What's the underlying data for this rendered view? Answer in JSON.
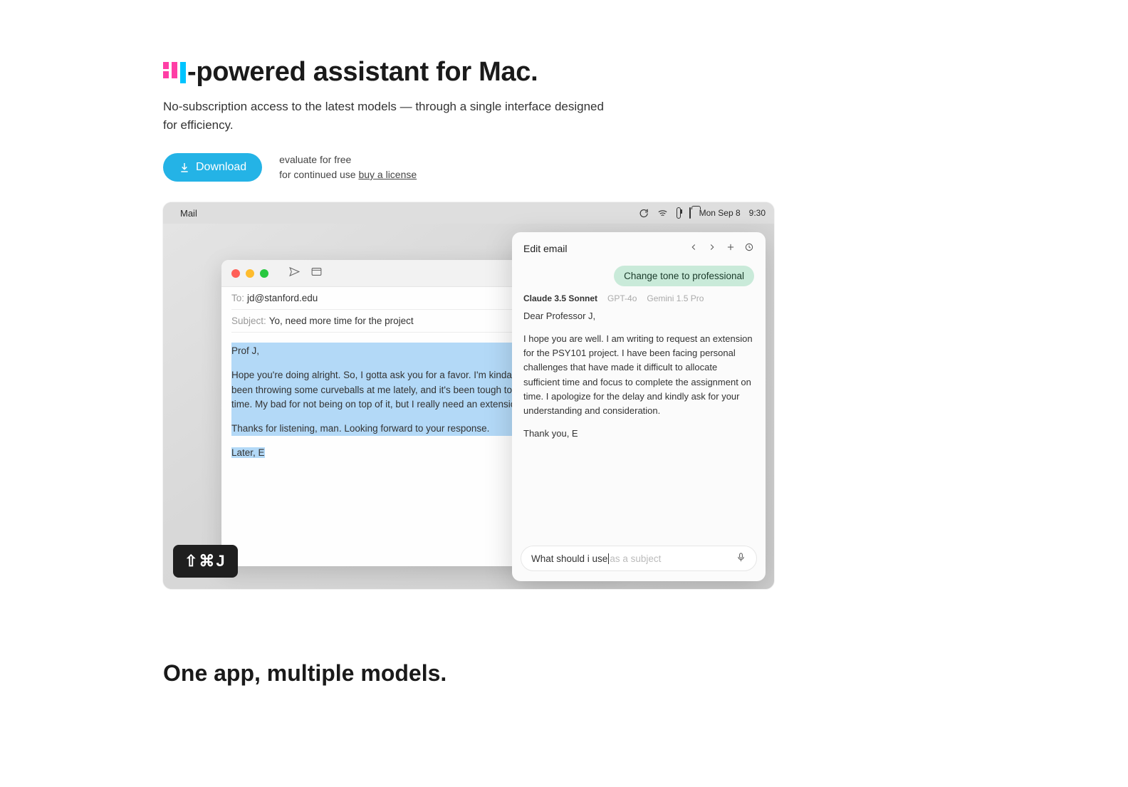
{
  "hero": {
    "title_rest": "-powered assistant for Mac.",
    "sub": "No-subscription access to the latest models — through a single interface designed for efficiency.",
    "download_label": "Download",
    "eval_line1": "evaluate for free",
    "eval_line2_prefix": "for continued use ",
    "eval_link": "buy a license"
  },
  "menubar": {
    "app": "Mail",
    "date": "Mon Sep 8",
    "time": "9:30"
  },
  "mail": {
    "to_label": "To:",
    "to_value": "jd@stanford.edu",
    "subject_label": "Subject:",
    "subject_value": "Yo, need more time for the project",
    "body_p1": "Prof J,",
    "body_p2": "Hope you're doing alright. So, I gotta ask you for a favor. I'm kinda struggling — life's been throwing some curveballs at me lately, and it's been tough to find the focus and time. My bad for not being on top of it, but I really need an extension.",
    "body_p3": "Thanks for listening, man. Looking forward to your response.",
    "body_p4": "Later, E"
  },
  "shortcut": "⇧⌘J",
  "assistant": {
    "header": "Edit email",
    "user_msg": "Change tone to professional",
    "models": {
      "active": "Claude 3.5 Sonnet",
      "m1": "GPT-4o",
      "m2": "Gemini 1.5 Pro"
    },
    "reply_p1": "Dear Professor J,",
    "reply_p2": "I hope you are well. I am writing to request an extension for the PSY101 project. I have been facing personal challenges that have made it difficult to allocate sufficient time and focus to complete the assignment on time. I apologize for the delay and kindly ask for your understanding and consideration.",
    "reply_p3": "Thank you, E",
    "input_typed": "What should i use",
    "input_ghost": " as a subject"
  },
  "section2_title": "One app, multiple models."
}
